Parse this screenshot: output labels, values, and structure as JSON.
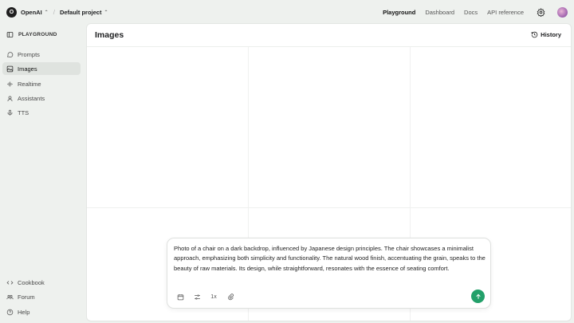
{
  "topbar": {
    "org": "OpenAI",
    "org_initial": "O",
    "project": "Default project",
    "nav": [
      "Playground",
      "Dashboard",
      "Docs",
      "API reference"
    ]
  },
  "sidebar": {
    "title": "PLAYGROUND",
    "items": [
      {
        "label": "Prompts",
        "icon": "chat-bubble-icon"
      },
      {
        "label": "Images",
        "icon": "image-icon",
        "active": true
      },
      {
        "label": "Realtime",
        "icon": "waveform-icon"
      },
      {
        "label": "Assistants",
        "icon": "assistant-icon"
      },
      {
        "label": "TTS",
        "icon": "microphone-icon"
      }
    ],
    "footer": [
      {
        "label": "Cookbook",
        "icon": "code-icon"
      },
      {
        "label": "Forum",
        "icon": "people-icon"
      },
      {
        "label": "Help",
        "icon": "help-icon"
      }
    ]
  },
  "main": {
    "title": "Images",
    "history_label": "History"
  },
  "prompt": {
    "text": "Photo of a chair on a dark backdrop, influenced by Japanese design principles. The chair showcases a minimalist approach, emphasizing both simplicity and functionality. The natural wood finish, accentuating the grain, speaks to the beauty of raw materials. Its design, while straightforward, resonates with the essence of seating comfort.",
    "count_label": "1x"
  },
  "colors": {
    "send": "#23a06a",
    "sidebar_bg": "#eef1ee",
    "active_item_bg": "#dfe3df"
  }
}
